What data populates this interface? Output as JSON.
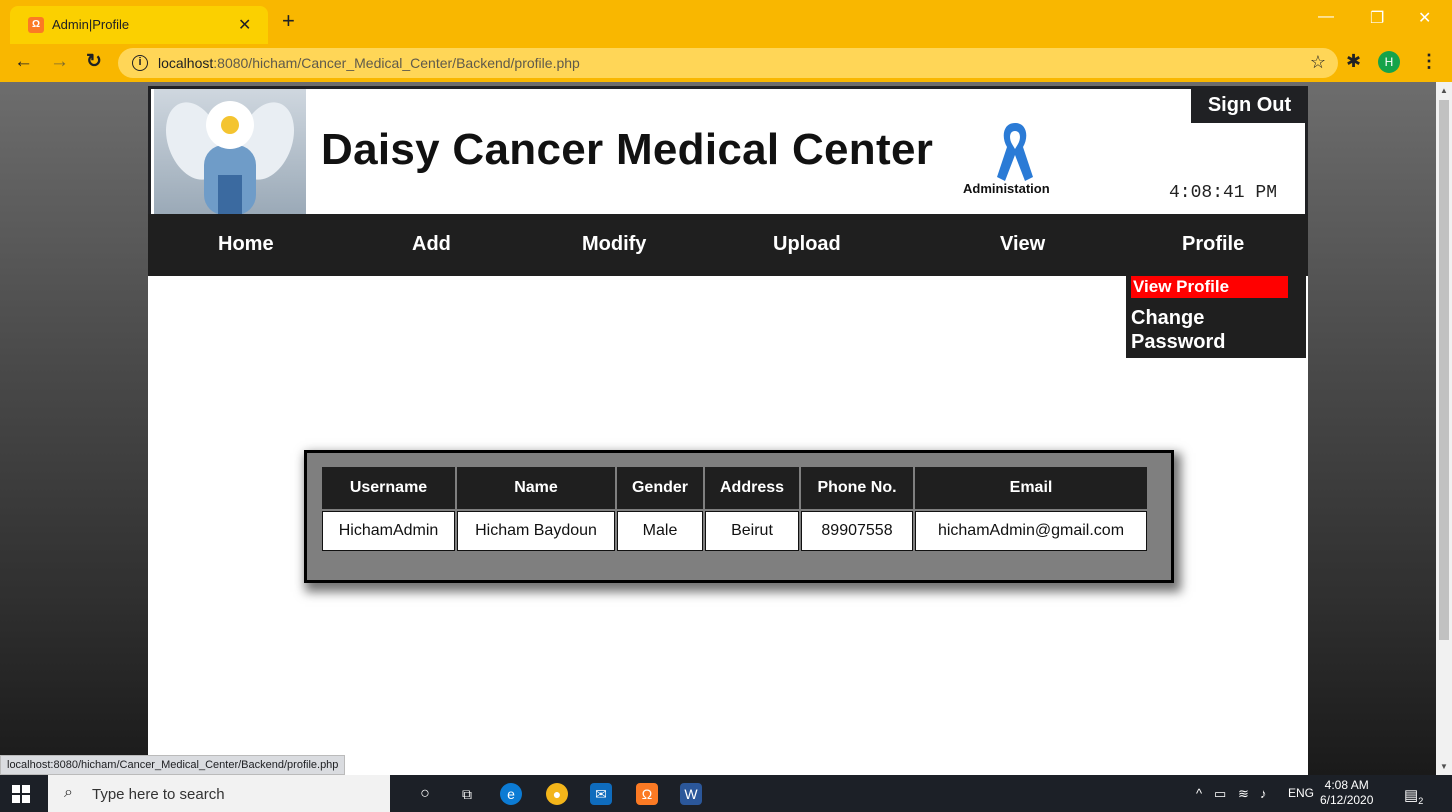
{
  "browser": {
    "tab_title": "Admin|Profile",
    "favicon_text": "Ω",
    "url_host": "localhost",
    "url_rest": ":8080/hicham/Cancer_Medical_Center/Backend/profile.php",
    "profile_initial": "H"
  },
  "site": {
    "title": "Daisy Cancer Medical Center",
    "subtitle": "Administation",
    "sign_out": "Sign Out",
    "clock": "4:08:41 PM",
    "ribbon_color": "#2b7bd6"
  },
  "nav": [
    {
      "label": "Home"
    },
    {
      "label": "Add"
    },
    {
      "label": "Modify"
    },
    {
      "label": "Upload"
    },
    {
      "label": "View"
    },
    {
      "label": "Profile"
    }
  ],
  "profile_menu": {
    "view_profile": "View Profile",
    "change_password": "Change Password"
  },
  "table": {
    "headers": [
      "Username",
      "Name",
      "Gender",
      "Address",
      "Phone No.",
      "Email"
    ],
    "row": [
      "HichamAdmin",
      "Hicham Baydoun",
      "Male",
      "Beirut",
      "89907558",
      "hichamAdmin@gmail.com"
    ]
  },
  "status_url": "localhost:8080/hicham/Cancer_Medical_Center/Backend/profile.php",
  "taskbar": {
    "search_placeholder": "Type here to search",
    "lang": "ENG",
    "time": "4:08 AM",
    "date": "6/12/2020",
    "notif_count": "2"
  },
  "colors": {
    "chrome_accent": "#f9b700",
    "nav_bg": "#1f1f1f",
    "active_menu": "#ff0000"
  }
}
